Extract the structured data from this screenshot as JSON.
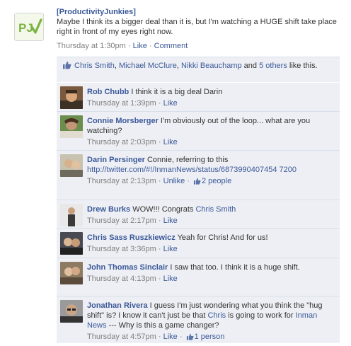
{
  "post": {
    "author": "[ProductivityJunkies]",
    "message": "Maybe I think its a bigger deal than it is, but I'm watching a HUGE shift take place right in front of my eyes right now.",
    "time": "Thursday at 1:30pm",
    "like_label": "Like",
    "comment_label": "Comment"
  },
  "likes": {
    "names": [
      "Chris Smith",
      "Michael McClure",
      "Nikki Beauchamp"
    ],
    "and_label": "and",
    "others": "5 others",
    "suffix": "like this."
  },
  "comments": [
    {
      "author": "Rob Chubb",
      "text": "I think it is a big deal Darin",
      "time": "Thursday at 1:39pm",
      "action": "Like"
    },
    {
      "author": "Connie Morsberger",
      "text": "I'm obviously out of the loop... what are you watching?",
      "time": "Thursday at 2:03pm",
      "action": "Like"
    },
    {
      "author": "Darin Persinger",
      "text": "Connie, referring to this",
      "link": "http://twitter.com/#!/InmanNews/status/6873990407454 7200",
      "time": "Thursday at 2:13pm",
      "action": "Unlike",
      "likes": "2 people"
    },
    {
      "author": "Drew Burks",
      "text": "WOW!!! Congrats",
      "mention": "Chris Smith",
      "time": "Thursday at 2:17pm",
      "action": "Like"
    },
    {
      "author": "Chris Sass Ruszkiewicz",
      "text": "Yeah for Chris! And for us!",
      "time": "Thursday at 3:36pm",
      "action": "Like"
    },
    {
      "author": "John Thomas Sinclair",
      "text": "I saw that too. I think it is a huge shift.",
      "time": "Thursday at 4:13pm",
      "action": "Like"
    },
    {
      "author": "Jonathan Rivera",
      "text_a": "I guess I'm just wondering what you think the \"hug shift\" is? I know it can't just be that",
      "mention_a": "Chris",
      "text_b": "is going to work for",
      "mention_b": "Inman News",
      "text_c": "--- Why is this a game changer?",
      "time": "Thursday at 4:57pm",
      "action": "Like",
      "likes": "1 person"
    }
  ],
  "icons": {
    "logo": "productivity-junkies-logo",
    "like": "thumbs-up-icon"
  },
  "colors": {
    "link": "#3b5998",
    "panel": "#edeff4",
    "logo_green": "#7cb342"
  }
}
